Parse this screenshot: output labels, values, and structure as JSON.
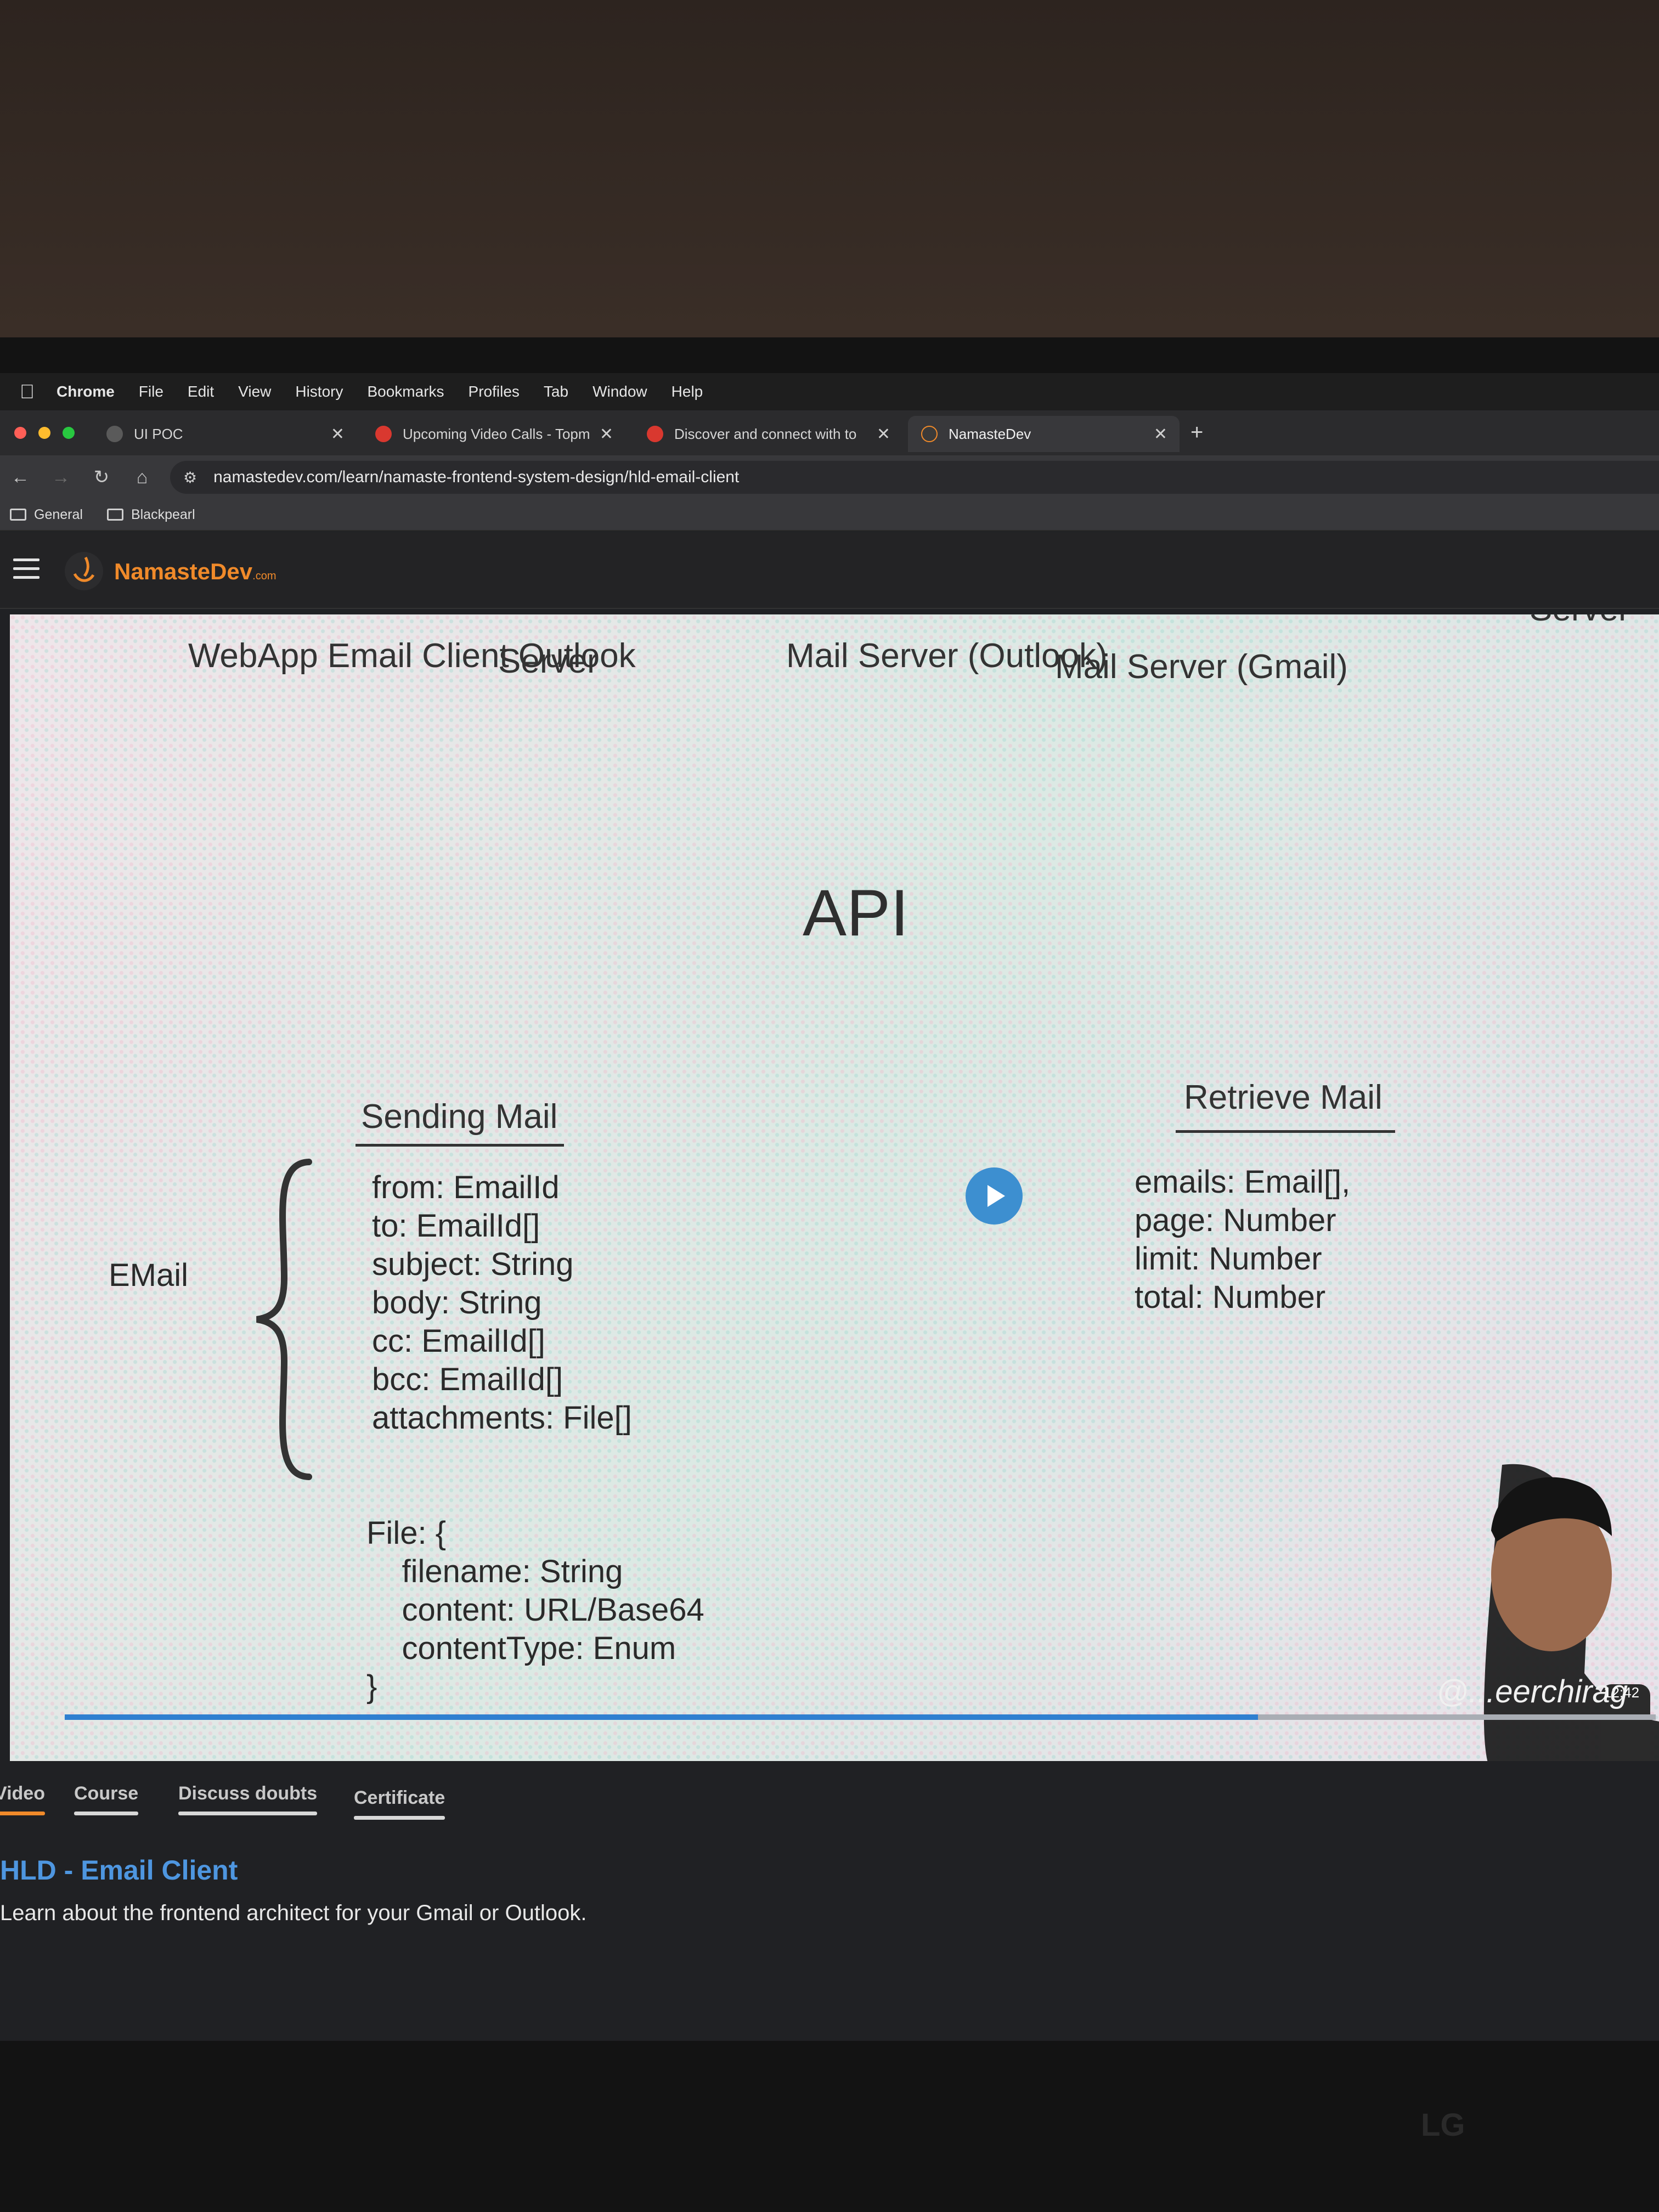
{
  "menubar": {
    "app": "Chrome",
    "items": [
      "File",
      "Edit",
      "View",
      "History",
      "Bookmarks",
      "Profiles",
      "Tab",
      "Window",
      "Help"
    ]
  },
  "tabs": [
    {
      "label": "UI POC",
      "active": false
    },
    {
      "label": "Upcoming Video Calls - Topm",
      "active": false
    },
    {
      "label": "Discover and connect with to",
      "active": false
    },
    {
      "label": "NamasteDev",
      "active": true
    }
  ],
  "address": {
    "url": "namastedev.com/learn/namaste-frontend-system-design/hld-email-client"
  },
  "bookmarks": [
    "General",
    "Blackpearl"
  ],
  "site": {
    "logo": "NamasteDev",
    "logo_suffix": ".com"
  },
  "slide": {
    "col_webapp": "WebApp\nEmail Client\nOutlook",
    "col_server": "Server",
    "col_mail_outlook": "Mail Server\n(Outlook)",
    "col_mail_gmail": "Mail Server\n(Gmail)",
    "col_cut": "Server",
    "api": "API",
    "sending_mail": "Sending Mail",
    "retrieve_mail": "Retrieve Mail",
    "email_label": "EMail",
    "email_fields": "from: EmailId\nto: EmailId[]\nsubject: String\nbody: String\ncc: EmailId[]\nbcc: EmailId[]\nattachments: File[]",
    "file_block": "File: {\n    filename: String\n    content: URL/Base64\n    contentType: Enum\n}",
    "retrieve_fields": "emails: Email[],\npage: Number\nlimit: Number\ntotal: Number"
  },
  "video": {
    "progress": 0.75,
    "timestamp": "12:42",
    "watermark": "@...eerchirag"
  },
  "lesson": {
    "tabs": [
      {
        "label": "Video",
        "active": true
      },
      {
        "label": "Course",
        "active": false
      },
      {
        "label": "Discuss doubts",
        "active": false
      },
      {
        "label": "Certificate",
        "active": false
      }
    ],
    "title": "HLD - Email Client",
    "description": "Learn about the frontend architect for your Gmail or Outlook."
  },
  "monitor_brand": "LG",
  "colors": {
    "accent_orange": "#f08a2a",
    "link_blue": "#4e96e0",
    "play_blue": "#3d8fd0"
  }
}
